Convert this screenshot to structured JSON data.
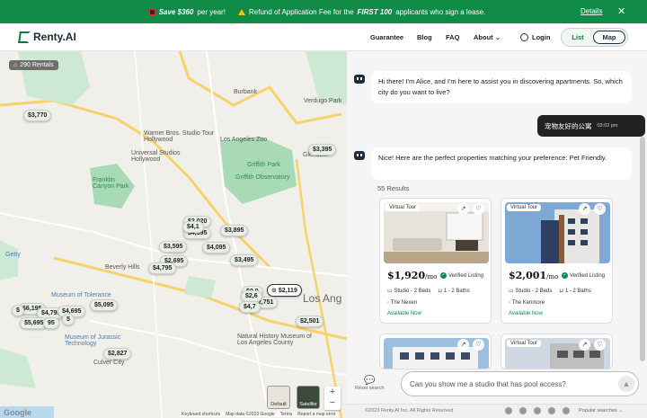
{
  "banner": {
    "promo_amount": "Save $360",
    "promo_suffix": "per year!",
    "refund_prefix": "Refund of Application Fee for the",
    "refund_highlight": "FIRST 100",
    "refund_suffix": "applicants who sign a lease.",
    "details_label": "Details",
    "close_glyph": "✕",
    "color": "#0f8a47"
  },
  "nav": {
    "logo_text": "Renty.AI",
    "links": [
      "Guarantee",
      "Blog",
      "FAQ",
      "About ⌄"
    ],
    "login_label": "Login",
    "view_toggle": {
      "list_label": "List",
      "map_label": "Map",
      "selected": "Map"
    }
  },
  "map": {
    "rentals_count_label": "290 Rentals",
    "price_pins": [
      "$3,770",
      "$3,395",
      "$2,020",
      "$4,395",
      "$3,895",
      "$3,595",
      "$4,095",
      "$2,695",
      "$3,495",
      "$4,795",
      "$2,119",
      "$2,751",
      "$5,095",
      "$6,195",
      "$4,795",
      "$5,695",
      "$2,501",
      "$2,827"
    ],
    "partial_pins": [
      "$2,9",
      "$2,6",
      "$4,7",
      "$4,695",
      "95",
      "5",
      "$",
      "$4,1"
    ],
    "places": [
      "Burbank",
      "Verdugo Park",
      "Warner Bros. Studio Tour Hollywood",
      "Los Angeles Zoo",
      "Universal Studios Hollywood",
      "Griffith Park",
      "Glendale",
      "Griffith Observatory",
      "Franklin Canyon Park",
      "Beverly Hills",
      "Getty",
      "Los Ang",
      "Museum of Tolerance",
      "Natural History Museum of Los Angeles County",
      "Museum of Jurassic Technology",
      "Culver City"
    ],
    "map_type_default": "Default",
    "map_type_satellite": "Satellite",
    "zoom_in": "+",
    "zoom_out": "−",
    "attribution": [
      "Keyboard shortcuts",
      "Map data ©2023 Google",
      "Terms",
      "Report a map error"
    ],
    "google_logo": "Google"
  },
  "chat": {
    "greeting": "Hi there! I'm Alice, and I'm here to assist you in discovering apartments. So, which city do you want to live?",
    "user_message": "宠物友好的公寓",
    "user_time": "03:02 pm",
    "reply": "Nice! Here are the perfect properties matching your preference: Pet Friendly.",
    "results_count": "55 Results",
    "cards": [
      {
        "tag": "Virtual Tour",
        "price": "$1,920",
        "per": "/mo",
        "verified": "Verified Listing",
        "beds": "Studio - 2 Beds",
        "baths": "1 - 2 Baths",
        "building": "The Nexen",
        "availability": "Available Now"
      },
      {
        "tag": "Virtual Tour",
        "price": "$2,001",
        "per": "/mo",
        "verified": "Verified Listing",
        "beds": "Studio - 2 Beds",
        "baths": "1 - 2 Baths",
        "building": "The Kenmore",
        "availability": "Available Now"
      },
      {
        "tag": "",
        "price": "",
        "per": "",
        "verified": "",
        "beds": "",
        "baths": "",
        "building": "",
        "availability": ""
      },
      {
        "tag": "Virtual Tour",
        "price": "",
        "per": "",
        "verified": "",
        "beds": "",
        "baths": "",
        "building": "",
        "availability": ""
      }
    ],
    "reset_label": "Reset search",
    "input_placeholder": "Can you show me a studio that has pool access?",
    "footer_copyright": "©2023 Renty.AI Inc. All Rights Reserved",
    "popular_searches": "Popular searches ⌄"
  },
  "colors": {
    "brand_green": "#0b7a3f",
    "dark": "#1d2b3a",
    "park_green": "#a8dab5"
  }
}
